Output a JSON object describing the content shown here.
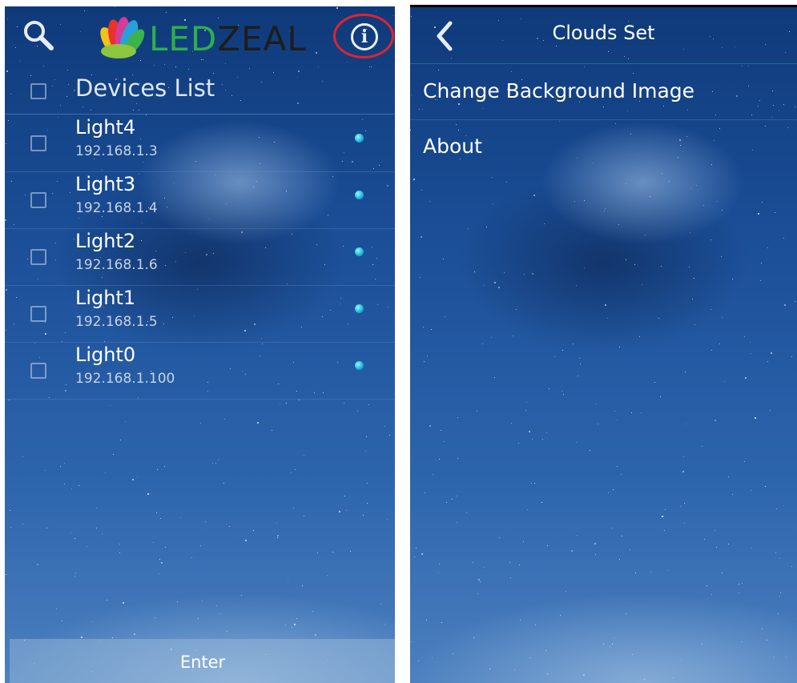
{
  "left": {
    "logo_text_led": "LED",
    "logo_text_zeal": "ZEAL",
    "list_title": "Devices List",
    "devices": [
      {
        "name": "Light4",
        "ip": "192.168.1.3"
      },
      {
        "name": "Light3",
        "ip": "192.168.1.4"
      },
      {
        "name": "Light2",
        "ip": "192.168.1.6"
      },
      {
        "name": "Light1",
        "ip": "192.168.1.5"
      },
      {
        "name": "Light0",
        "ip": "192.168.1.100"
      }
    ],
    "enter_label": "Enter",
    "icons": {
      "search": "search-icon",
      "info": "info-icon",
      "status": "online-dot-icon"
    }
  },
  "right": {
    "title": "Clouds Set",
    "menu": [
      {
        "label": "Change Background Image"
      },
      {
        "label": "About"
      }
    ],
    "icons": {
      "back": "chevron-left-icon"
    }
  },
  "colors": {
    "highlight": "#e0232f",
    "status_dot": "#18b4d8",
    "logo_led": "#2fae4a",
    "logo_zeal": "#1d1d1d"
  }
}
